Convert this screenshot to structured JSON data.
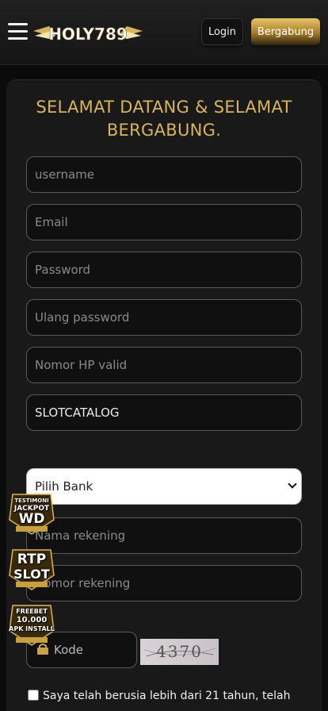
{
  "header": {
    "logo_text": "HOLY789",
    "login_label": "Login",
    "join_label": "Bergabung"
  },
  "form": {
    "title": "SELAMAT DATANG & SELAMAT BERGABUNG.",
    "username_placeholder": "username",
    "email_placeholder": "Email",
    "password_placeholder": "Password",
    "confirm_password_placeholder": "Ulang password",
    "phone_placeholder": "Nomor HP valid",
    "referral_value": "SLOTCATALOG",
    "bank_selected": "Pilih Bank",
    "account_name_placeholder": "Nama rekening",
    "account_number_placeholder": "Nomor rekening",
    "code_placeholder": "Kode",
    "captcha_text": "4370",
    "agree_text": "Saya telah berusia lebih dari 21 tahun, telah"
  },
  "promos": [
    {
      "line1": "TESTIMONI",
      "line2": "JACKPOT",
      "line3": "WD"
    },
    {
      "line1": "RTP",
      "line2": "SLOT",
      "line3": ""
    },
    {
      "line1": "FREEBET",
      "line2": "10.000",
      "line3": "APK INSTALL"
    }
  ],
  "colors": {
    "accent_gold": "#d9b460",
    "background": "#0b0b0b",
    "card": "#191919"
  }
}
